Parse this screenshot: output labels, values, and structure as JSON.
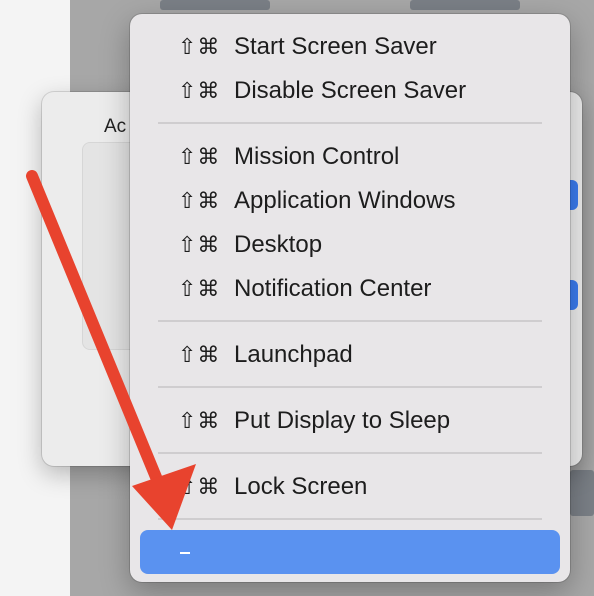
{
  "dialog": {
    "title": "Ac"
  },
  "menu": {
    "groups": [
      [
        {
          "shortcut": "⇧⌘",
          "label": "Start Screen Saver"
        },
        {
          "shortcut": "⇧⌘",
          "label": "Disable Screen Saver"
        }
      ],
      [
        {
          "shortcut": "⇧⌘",
          "label": "Mission Control"
        },
        {
          "shortcut": "⇧⌘",
          "label": "Application Windows"
        },
        {
          "shortcut": "⇧⌘",
          "label": "Desktop"
        },
        {
          "shortcut": "⇧⌘",
          "label": "Notification Center"
        }
      ],
      [
        {
          "shortcut": "⇧⌘",
          "label": "Launchpad"
        }
      ],
      [
        {
          "shortcut": "⇧⌘",
          "label": "Put Display to Sleep"
        }
      ],
      [
        {
          "shortcut": "⇧⌘",
          "label": "Lock Screen"
        }
      ]
    ],
    "selected_item": {
      "label": "-"
    }
  },
  "colors": {
    "selection": "#5a92f0",
    "accent": "#3a7cf0",
    "annotation_arrow": "#e8432e"
  }
}
